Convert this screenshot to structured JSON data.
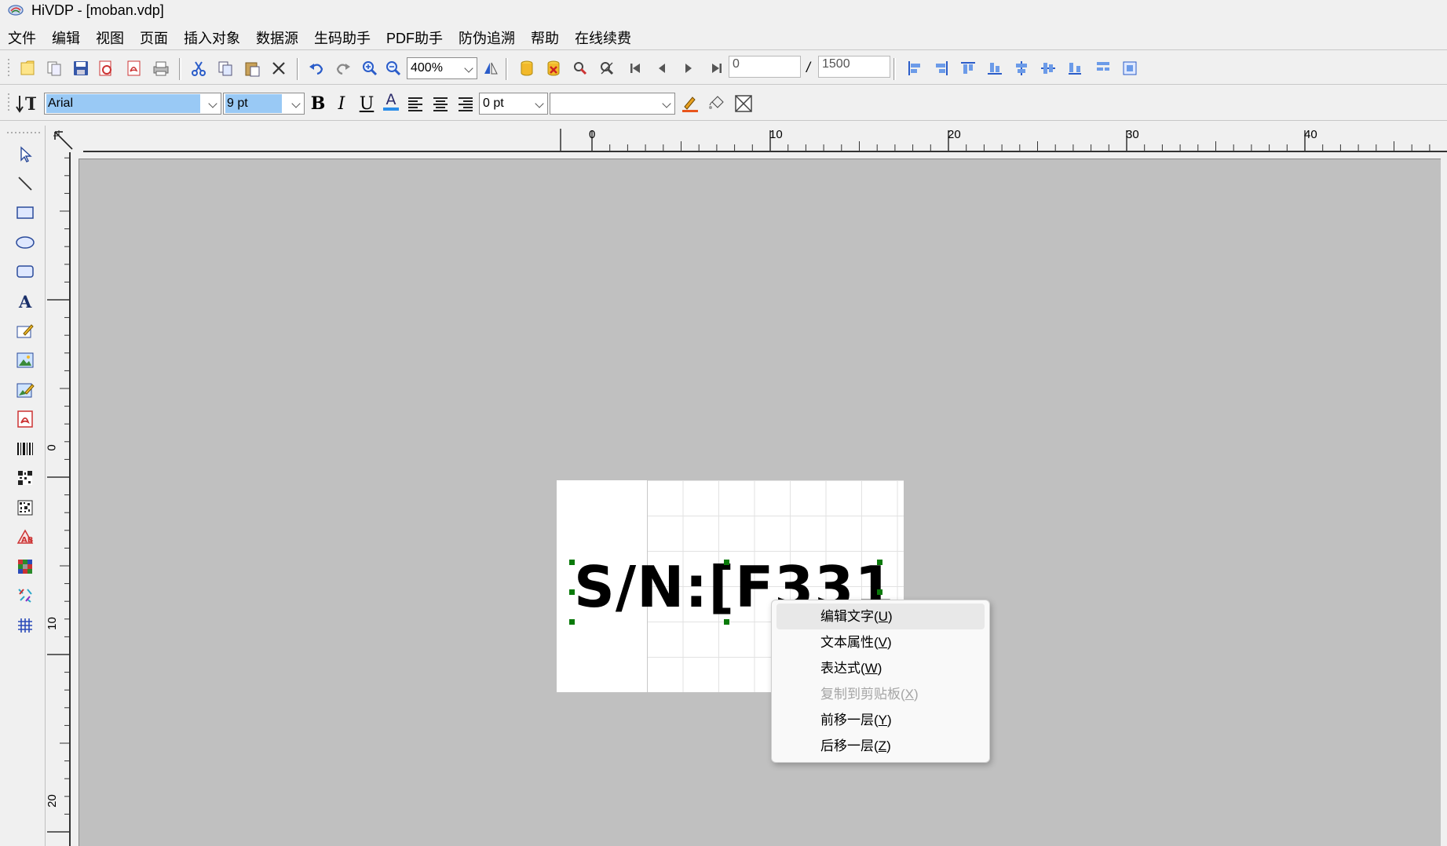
{
  "window": {
    "title": "HiVDP - [moban.vdp]"
  },
  "menubar": {
    "items": [
      "文件",
      "编辑",
      "视图",
      "页面",
      "插入对象",
      "数据源",
      "生码助手",
      "PDF助手",
      "防伪追溯",
      "帮助",
      "在线续费"
    ]
  },
  "toolbar1": {
    "zoom_value": "400%",
    "page_from": "0",
    "page_separator": "/",
    "page_total": "1500"
  },
  "toolbar2": {
    "font_family": "Arial",
    "font_size": "9 pt",
    "bold": "B",
    "italic": "I",
    "underline": "U",
    "font_color": "A",
    "line_spacing": "0 pt",
    "extra_combo": ""
  },
  "rulers": {
    "horizontal_labels": [
      "0",
      "10",
      "20",
      "30",
      "40"
    ],
    "vertical_labels": [
      "0",
      "10",
      "20"
    ]
  },
  "canvas": {
    "label_text": "S/N:[F331"
  },
  "context_menu": {
    "items": [
      {
        "label": "编辑文字(",
        "key": "U",
        "close": ")",
        "enabled": true
      },
      {
        "label": "文本属性(",
        "key": "V",
        "close": ")",
        "enabled": true
      },
      {
        "label": "表达式(",
        "key": "W",
        "close": ")",
        "enabled": true
      },
      {
        "label": "复制到剪贴板(",
        "key": "X",
        "close": ")",
        "enabled": false
      },
      {
        "label": "前移一层(",
        "key": "Y",
        "close": ")",
        "enabled": true
      },
      {
        "label": "后移一层(",
        "key": "Z",
        "close": ")",
        "enabled": true
      }
    ]
  },
  "colors": {
    "canvas_bg": "#c0c0c0",
    "selection_handle": "#0a7a0a",
    "font_field_highlight": "#99c9f5"
  }
}
